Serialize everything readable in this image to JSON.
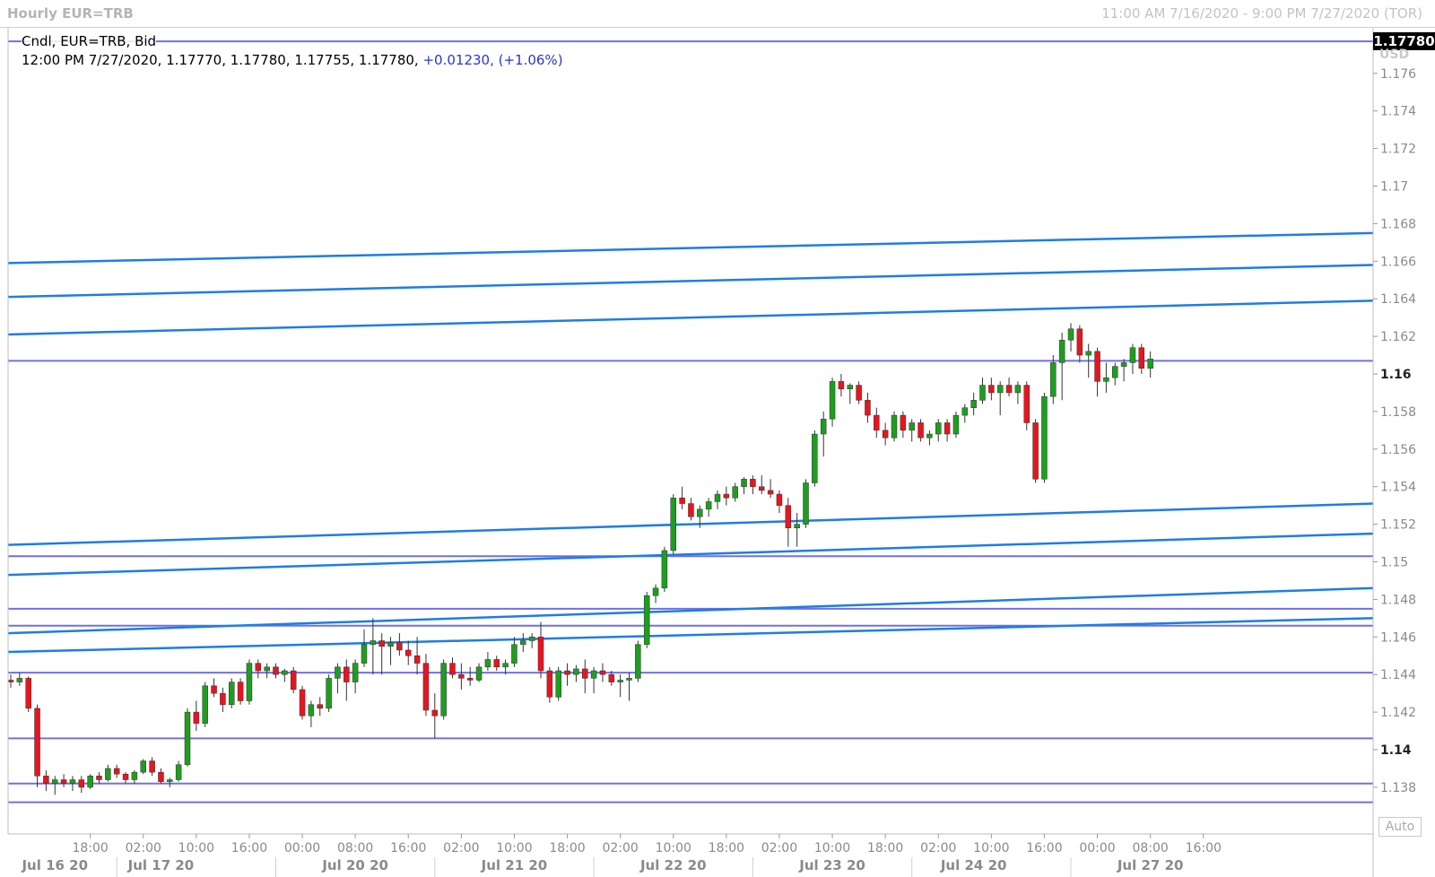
{
  "window": {
    "title": "Hourly EUR=TRB",
    "range": "11:00 AM 7/16/2020 - 9:00 PM 7/27/2020 (TOR)"
  },
  "legend": {
    "series": "Cndl, EUR=TRB, Bid",
    "ohlc": "12:00 PM 7/27/2020, 1.17770, 1.17780, 1.17755, 1.17780,",
    "change": "+0.01230, (+1.06%)"
  },
  "price_tag": "1.17780",
  "currency": "USD",
  "auto_label": "Auto",
  "colors": {
    "up": "#1e9e1e",
    "down": "#e8141e",
    "trendline": "#1e7de6",
    "hline": "#7070e6",
    "grid": "#d8d8d8",
    "axis_text": "#8a8a8a"
  },
  "chart_data": {
    "type": "candlestick",
    "ylim": [
      1.1365,
      1.1785
    ],
    "y_ticks": [
      {
        "v": 1.138,
        "label": "1.138"
      },
      {
        "v": 1.14,
        "label": "1.14",
        "bold": true
      },
      {
        "v": 1.142,
        "label": "1.142"
      },
      {
        "v": 1.144,
        "label": "1.144"
      },
      {
        "v": 1.146,
        "label": "1.146"
      },
      {
        "v": 1.148,
        "label": "1.148"
      },
      {
        "v": 1.15,
        "label": "1.15"
      },
      {
        "v": 1.152,
        "label": "1.152"
      },
      {
        "v": 1.154,
        "label": "1.154"
      },
      {
        "v": 1.156,
        "label": "1.156"
      },
      {
        "v": 1.158,
        "label": "1.158"
      },
      {
        "v": 1.16,
        "label": "1.16",
        "bold": true
      },
      {
        "v": 1.162,
        "label": "1.162"
      },
      {
        "v": 1.164,
        "label": "1.164"
      },
      {
        "v": 1.166,
        "label": "1.166"
      },
      {
        "v": 1.168,
        "label": "1.168"
      },
      {
        "v": 1.17,
        "label": "1.17"
      },
      {
        "v": 1.172,
        "label": "1.172"
      },
      {
        "v": 1.174,
        "label": "1.174"
      },
      {
        "v": 1.176,
        "label": "1.176"
      }
    ],
    "x_time_ticks": [
      {
        "i": 9,
        "label": "18:00"
      },
      {
        "i": 15,
        "label": "02:00"
      },
      {
        "i": 21,
        "label": "10:00"
      },
      {
        "i": 27,
        "label": "16:00"
      },
      {
        "i": 33,
        "label": "00:00"
      },
      {
        "i": 39,
        "label": "08:00"
      },
      {
        "i": 45,
        "label": "16:00"
      },
      {
        "i": 51,
        "label": "02:00"
      },
      {
        "i": 57,
        "label": "10:00"
      },
      {
        "i": 63,
        "label": "18:00"
      },
      {
        "i": 69,
        "label": "02:00"
      },
      {
        "i": 75,
        "label": "10:00"
      },
      {
        "i": 81,
        "label": "18:00"
      },
      {
        "i": 87,
        "label": "02:00"
      },
      {
        "i": 93,
        "label": "10:00"
      },
      {
        "i": 99,
        "label": "18:00"
      },
      {
        "i": 105,
        "label": "02:00"
      },
      {
        "i": 111,
        "label": "10:00"
      },
      {
        "i": 117,
        "label": "16:00"
      },
      {
        "i": 123,
        "label": "00:00"
      },
      {
        "i": 129,
        "label": "08:00"
      },
      {
        "i": 135,
        "label": "16:00"
      }
    ],
    "x_date_ticks": [
      {
        "i": 5,
        "label": "Jul 16 20"
      },
      {
        "i": 17,
        "label": "Jul 17 20"
      },
      {
        "i": 39,
        "label": "Jul 20 20"
      },
      {
        "i": 57,
        "label": "Jul 21 20"
      },
      {
        "i": 75,
        "label": "Jul 22 20"
      },
      {
        "i": 93,
        "label": "Jul 23 20"
      },
      {
        "i": 109,
        "label": "Jul 24 20"
      },
      {
        "i": 129,
        "label": "Jul 27 20"
      }
    ],
    "date_separators": [
      12,
      30,
      48,
      66,
      84,
      102,
      120
    ],
    "horizontal_lines": [
      1.1777,
      1.1607,
      1.1503,
      1.1475,
      1.1466,
      1.1441,
      1.1406,
      1.1382,
      1.1372
    ],
    "trend_lines": [
      {
        "y1": 1.1659,
        "y2": 1.1675
      },
      {
        "y1": 1.1641,
        "y2": 1.1658
      },
      {
        "y1": 1.1621,
        "y2": 1.1639
      },
      {
        "y1": 1.1509,
        "y2": 1.1531
      },
      {
        "y1": 1.1493,
        "y2": 1.1515
      },
      {
        "y1": 1.1462,
        "y2": 1.1486
      },
      {
        "y1": 1.1452,
        "y2": 1.147
      }
    ],
    "candles": [
      [
        1.1437,
        1.144,
        1.1433,
        1.1436
      ],
      [
        1.1436,
        1.1441,
        1.1434,
        1.1438
      ],
      [
        1.1438,
        1.1439,
        1.142,
        1.1422
      ],
      [
        1.1422,
        1.1424,
        1.138,
        1.1386
      ],
      [
        1.1386,
        1.1389,
        1.1378,
        1.1382
      ],
      [
        1.1382,
        1.1386,
        1.1376,
        1.1384
      ],
      [
        1.1384,
        1.1387,
        1.138,
        1.1382
      ],
      [
        1.1382,
        1.1386,
        1.1378,
        1.1384
      ],
      [
        1.1384,
        1.1386,
        1.1377,
        1.138
      ],
      [
        1.138,
        1.1387,
        1.1379,
        1.1386
      ],
      [
        1.1386,
        1.1388,
        1.1382,
        1.1384
      ],
      [
        1.1384,
        1.1392,
        1.1383,
        1.139
      ],
      [
        1.139,
        1.1392,
        1.1385,
        1.1387
      ],
      [
        1.1387,
        1.1388,
        1.1382,
        1.1384
      ],
      [
        1.1384,
        1.1389,
        1.1382,
        1.1388
      ],
      [
        1.1388,
        1.1395,
        1.1387,
        1.1394
      ],
      [
        1.1394,
        1.1396,
        1.1386,
        1.1388
      ],
      [
        1.1388,
        1.139,
        1.1382,
        1.1383
      ],
      [
        1.1383,
        1.1385,
        1.138,
        1.1384
      ],
      [
        1.1384,
        1.1394,
        1.1383,
        1.1392
      ],
      [
        1.1392,
        1.1422,
        1.1391,
        1.142
      ],
      [
        1.142,
        1.1426,
        1.141,
        1.1414
      ],
      [
        1.1414,
        1.1436,
        1.1412,
        1.1434
      ],
      [
        1.1434,
        1.1438,
        1.1428,
        1.143
      ],
      [
        1.143,
        1.1433,
        1.142,
        1.1424
      ],
      [
        1.1424,
        1.1438,
        1.1422,
        1.1436
      ],
      [
        1.1436,
        1.1438,
        1.1424,
        1.1426
      ],
      [
        1.1426,
        1.1448,
        1.1424,
        1.1446
      ],
      [
        1.1446,
        1.1448,
        1.1438,
        1.1442
      ],
      [
        1.1442,
        1.1446,
        1.1438,
        1.1444
      ],
      [
        1.1444,
        1.1446,
        1.1438,
        1.144
      ],
      [
        1.144,
        1.1443,
        1.1436,
        1.1442
      ],
      [
        1.1442,
        1.1444,
        1.143,
        1.1432
      ],
      [
        1.1432,
        1.1434,
        1.1416,
        1.1418
      ],
      [
        1.1418,
        1.1426,
        1.1412,
        1.1424
      ],
      [
        1.1424,
        1.1428,
        1.1418,
        1.1422
      ],
      [
        1.1422,
        1.144,
        1.142,
        1.1438
      ],
      [
        1.1438,
        1.1446,
        1.143,
        1.1444
      ],
      [
        1.1444,
        1.1448,
        1.1426,
        1.1436
      ],
      [
        1.1436,
        1.1448,
        1.143,
        1.1446
      ],
      [
        1.1446,
        1.1464,
        1.1444,
        1.1456
      ],
      [
        1.1456,
        1.147,
        1.144,
        1.1458
      ],
      [
        1.1458,
        1.1462,
        1.144,
        1.1455
      ],
      [
        1.1455,
        1.146,
        1.1445,
        1.1457
      ],
      [
        1.1457,
        1.1462,
        1.145,
        1.1453
      ],
      [
        1.1453,
        1.1458,
        1.1445,
        1.145
      ],
      [
        1.145,
        1.146,
        1.144,
        1.1446
      ],
      [
        1.1446,
        1.1451,
        1.1418,
        1.1421
      ],
      [
        1.1421,
        1.143,
        1.1406,
        1.1418
      ],
      [
        1.1418,
        1.1448,
        1.1416,
        1.1446
      ],
      [
        1.1446,
        1.1449,
        1.1438,
        1.144
      ],
      [
        1.144,
        1.1446,
        1.1432,
        1.1438
      ],
      [
        1.1438,
        1.1444,
        1.1434,
        1.1437
      ],
      [
        1.1437,
        1.1446,
        1.1436,
        1.1444
      ],
      [
        1.1444,
        1.1452,
        1.1442,
        1.1448
      ],
      [
        1.1448,
        1.145,
        1.1442,
        1.1444
      ],
      [
        1.1444,
        1.1448,
        1.144,
        1.1446
      ],
      [
        1.1446,
        1.146,
        1.1444,
        1.1456
      ],
      [
        1.1456,
        1.1462,
        1.1452,
        1.1458
      ],
      [
        1.1458,
        1.1462,
        1.1454,
        1.146
      ],
      [
        1.146,
        1.1468,
        1.1438,
        1.1442
      ],
      [
        1.1442,
        1.1444,
        1.1425,
        1.1428
      ],
      [
        1.1428,
        1.1444,
        1.1426,
        1.1442
      ],
      [
        1.1442,
        1.1446,
        1.1434,
        1.144
      ],
      [
        1.144,
        1.1445,
        1.1436,
        1.1443
      ],
      [
        1.1443,
        1.1448,
        1.143,
        1.1438
      ],
      [
        1.1438,
        1.1444,
        1.143,
        1.1442
      ],
      [
        1.1442,
        1.1446,
        1.1436,
        1.144
      ],
      [
        1.144,
        1.1442,
        1.1434,
        1.1436
      ],
      [
        1.1436,
        1.144,
        1.1428,
        1.1437
      ],
      [
        1.1437,
        1.1441,
        1.1426,
        1.1438
      ],
      [
        1.1438,
        1.1458,
        1.1436,
        1.1456
      ],
      [
        1.1456,
        1.1484,
        1.1454,
        1.1482
      ],
      [
        1.1482,
        1.1488,
        1.1478,
        1.1486
      ],
      [
        1.1486,
        1.1508,
        1.1484,
        1.1506
      ],
      [
        1.1506,
        1.1536,
        1.1504,
        1.1534
      ],
      [
        1.1534,
        1.154,
        1.1528,
        1.1531
      ],
      [
        1.1531,
        1.1534,
        1.1522,
        1.1524
      ],
      [
        1.1524,
        1.153,
        1.1518,
        1.1528
      ],
      [
        1.1528,
        1.1534,
        1.1524,
        1.1532
      ],
      [
        1.1532,
        1.1538,
        1.1528,
        1.1536
      ],
      [
        1.1536,
        1.154,
        1.153,
        1.1534
      ],
      [
        1.1534,
        1.1542,
        1.1532,
        1.154
      ],
      [
        1.154,
        1.1545,
        1.1536,
        1.1544
      ],
      [
        1.1544,
        1.1546,
        1.1536,
        1.154
      ],
      [
        1.154,
        1.1546,
        1.1536,
        1.1538
      ],
      [
        1.1538,
        1.1544,
        1.1534,
        1.1536
      ],
      [
        1.1536,
        1.1538,
        1.1526,
        1.153
      ],
      [
        1.153,
        1.1534,
        1.1508,
        1.1518
      ],
      [
        1.1518,
        1.1526,
        1.1508,
        1.152
      ],
      [
        1.152,
        1.1544,
        1.1518,
        1.1542
      ],
      [
        1.1542,
        1.157,
        1.154,
        1.1568
      ],
      [
        1.1568,
        1.158,
        1.1556,
        1.1576
      ],
      [
        1.1576,
        1.1598,
        1.1572,
        1.1596
      ],
      [
        1.1596,
        1.16,
        1.1588,
        1.1592
      ],
      [
        1.1592,
        1.1595,
        1.1584,
        1.1594
      ],
      [
        1.1594,
        1.1596,
        1.1584,
        1.1586
      ],
      [
        1.1586,
        1.159,
        1.1574,
        1.1578
      ],
      [
        1.1578,
        1.1582,
        1.1566,
        1.157
      ],
      [
        1.157,
        1.1574,
        1.1562,
        1.1566
      ],
      [
        1.1566,
        1.158,
        1.1564,
        1.1578
      ],
      [
        1.1578,
        1.158,
        1.1566,
        1.157
      ],
      [
        1.157,
        1.1576,
        1.1564,
        1.1574
      ],
      [
        1.1574,
        1.1576,
        1.1564,
        1.1566
      ],
      [
        1.1566,
        1.157,
        1.1562,
        1.1568
      ],
      [
        1.1568,
        1.1576,
        1.1564,
        1.1574
      ],
      [
        1.1574,
        1.1576,
        1.1564,
        1.1568
      ],
      [
        1.1568,
        1.158,
        1.1566,
        1.1578
      ],
      [
        1.1578,
        1.1584,
        1.1574,
        1.1582
      ],
      [
        1.1582,
        1.159,
        1.1578,
        1.1586
      ],
      [
        1.1586,
        1.1598,
        1.1584,
        1.1594
      ],
      [
        1.1594,
        1.1598,
        1.1586,
        1.159
      ],
      [
        1.159,
        1.1596,
        1.1578,
        1.1594
      ],
      [
        1.1594,
        1.1598,
        1.1588,
        1.159
      ],
      [
        1.159,
        1.1596,
        1.1584,
        1.1594
      ],
      [
        1.1594,
        1.1596,
        1.157,
        1.1574
      ],
      [
        1.1574,
        1.1576,
        1.1542,
        1.1544
      ],
      [
        1.1544,
        1.159,
        1.1542,
        1.1588
      ],
      [
        1.1588,
        1.161,
        1.1584,
        1.1606
      ],
      [
        1.1606,
        1.1622,
        1.1586,
        1.1618
      ],
      [
        1.1618,
        1.1627,
        1.1612,
        1.1624
      ],
      [
        1.1624,
        1.1626,
        1.1606,
        1.161
      ],
      [
        1.161,
        1.1616,
        1.1598,
        1.1612
      ],
      [
        1.1612,
        1.1614,
        1.1588,
        1.1596
      ],
      [
        1.1596,
        1.1606,
        1.159,
        1.1598
      ],
      [
        1.1598,
        1.1606,
        1.1594,
        1.1604
      ],
      [
        1.1604,
        1.1608,
        1.1596,
        1.1606
      ],
      [
        1.1606,
        1.1616,
        1.16,
        1.1614
      ],
      [
        1.1614,
        1.1616,
        1.16,
        1.1603
      ],
      [
        1.1603,
        1.1612,
        1.1598,
        1.1608
      ]
    ]
  }
}
